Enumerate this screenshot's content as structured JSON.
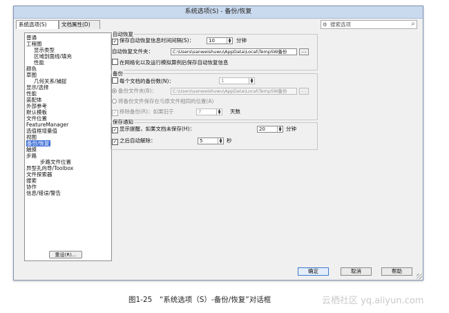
{
  "window": {
    "title": "系统选项(S) - 备份/恢复"
  },
  "tabs": [
    "系统选项(S)",
    "文档属性(D)"
  ],
  "search": {
    "placeholder": "搜索选项"
  },
  "tree": [
    {
      "label": "普通",
      "level": 0
    },
    {
      "label": "工程图",
      "level": 0
    },
    {
      "label": "显示类型",
      "level": 1
    },
    {
      "label": "区域剖面线/填充",
      "level": 1
    },
    {
      "label": "性能",
      "level": 1
    },
    {
      "label": "颜色",
      "level": 0
    },
    {
      "label": "草图",
      "level": 0
    },
    {
      "label": "几何关系/捕捉",
      "level": 1
    },
    {
      "label": "显示/选择",
      "level": 0
    },
    {
      "label": "性能",
      "level": 0
    },
    {
      "label": "装配体",
      "level": 0
    },
    {
      "label": "外部参考",
      "level": 0
    },
    {
      "label": "默认模板",
      "level": 0
    },
    {
      "label": "文件位置",
      "level": 0
    },
    {
      "label": "FeatureManager",
      "level": 0
    },
    {
      "label": "选值框增量值",
      "level": 0
    },
    {
      "label": "视图",
      "level": 0
    },
    {
      "label": "备份/恢复",
      "level": 0,
      "selected": true
    },
    {
      "label": "触摸",
      "level": 0
    },
    {
      "label": "步路",
      "level": 0
    },
    {
      "label": "步路文件位置",
      "level": 2
    },
    {
      "label": "异型孔向导/Toolbox",
      "level": 0
    },
    {
      "label": "文件探索器",
      "level": 0
    },
    {
      "label": "搜索",
      "level": 0
    },
    {
      "label": "协作",
      "level": 0
    },
    {
      "label": "信息/错误/警告",
      "level": 0
    }
  ],
  "reset_label": "重设(R)...",
  "autorecover": {
    "title": "自动恢复",
    "save_label": "保存自动恢复信息时间间隔(S)：",
    "interval": "10",
    "interval_unit": "分钟",
    "folder_label": "自动恢复文件夹：",
    "folder_path": "C:\\Users\\sanweishuwu\\AppData\\Local\\TempSW备份",
    "network_label": "在网格化以及运行模拟算例后保存自动恢复信息"
  },
  "backup": {
    "title": "备份",
    "copies_label": "每个文档的备份数(N)：",
    "copies_value": "1",
    "folder_label": "备份文件夹(B)：",
    "folder_path": "C:\\Users\\sanweishuwu\\AppData\\Local\\TempSW备份",
    "same_location_label": "将备份文件保存在与原文件相同的位置(A)",
    "remove_label": "移除备份(R)：如果旧于",
    "remove_value": "7",
    "remove_unit": "天数"
  },
  "save_notify": {
    "title": "保存通知",
    "show_label": "显示提醒，如果文档未保存(H)：",
    "show_value": "20",
    "show_unit": "分钟",
    "dismiss_label": "之后自动解除：",
    "dismiss_value": "5",
    "dismiss_unit": "秒"
  },
  "buttons": {
    "ok": "确定",
    "cancel": "取消",
    "help": "帮助"
  },
  "caption": "图1-25　“系统选项（S）-备份/恢复”对话框",
  "watermark": "云栖社区 yq.aliyun.com"
}
